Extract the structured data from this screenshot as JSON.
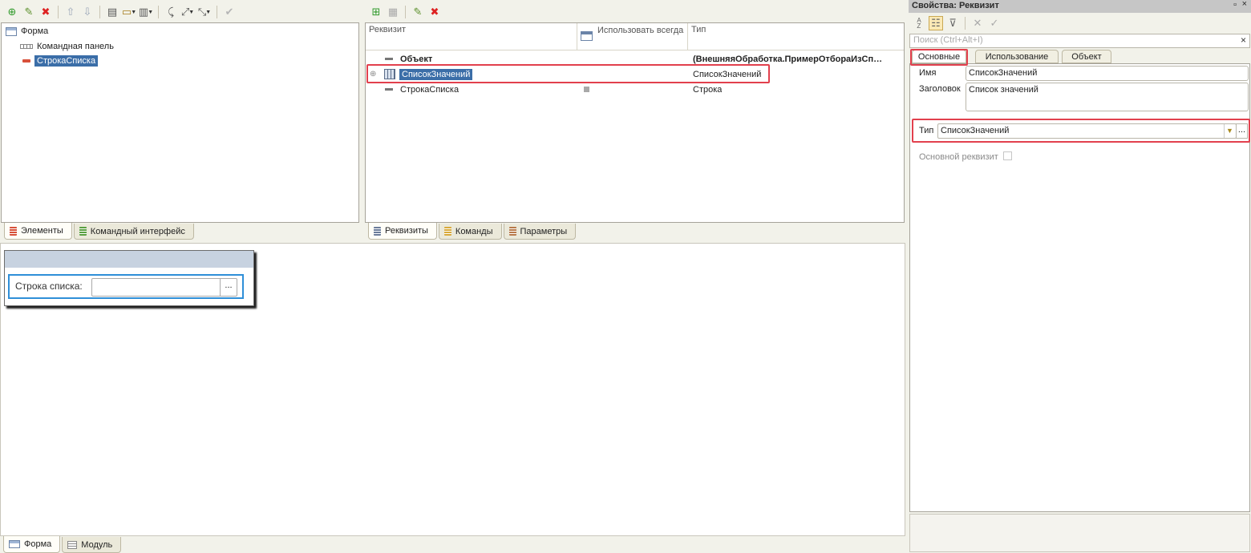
{
  "left_tree": {
    "items": [
      {
        "label": "Форма",
        "icon": "form-icon"
      },
      {
        "label": "Командная панель",
        "icon": "command-panel-icon"
      },
      {
        "label": "СтрокаСписка",
        "icon": "field-icon"
      }
    ],
    "tabs": [
      {
        "label": "Элементы",
        "icon": "elements-icon",
        "color": "#d8513a"
      },
      {
        "label": "Командный интерфейс",
        "icon": "command-interface-icon",
        "color": "#5aa041"
      }
    ]
  },
  "requisites": {
    "columns": {
      "name": "Реквизит",
      "use_always": "Использовать всегда",
      "type": "Тип"
    },
    "rows": [
      {
        "name": "Объект",
        "type": "(ВнешняяОбработка.ПримерОтбораИзСп…",
        "bold": true,
        "icon": "minus-icon"
      },
      {
        "name": "СписокЗначений",
        "type": "СписокЗначений",
        "icon": "value-list-icon",
        "selected": true
      },
      {
        "name": "СтрокаСписка",
        "type": "Строка",
        "icon": "minus-icon"
      }
    ],
    "tabs": [
      {
        "label": "Реквизиты",
        "color": "#6b7c9a"
      },
      {
        "label": "Команды",
        "color": "#d8a93a"
      },
      {
        "label": "Параметры",
        "color": "#b87a4a"
      }
    ]
  },
  "form_preview": {
    "field_label": "Строка списка:",
    "field_value": "",
    "choice_button": "..."
  },
  "bottom_tabs": [
    {
      "label": "Форма",
      "icon": "form-icon"
    },
    {
      "label": "Модуль",
      "icon": "module-icon"
    }
  ],
  "properties": {
    "title": "Свойства: Реквизит",
    "pin": "▫",
    "close": "×",
    "search_placeholder": "Поиск (Ctrl+Alt+I)",
    "search_clear": "×",
    "tabs": [
      "Основные",
      "Использование",
      "Объект"
    ],
    "name_label": "Имя",
    "name_value": "СписокЗначений",
    "title_label": "Заголовок",
    "title_value": "Список значений",
    "type_label": "Тип",
    "type_value": "СписокЗначений",
    "type_more": "...",
    "main_req_label": "Основной реквизит"
  },
  "colors": {
    "accent": "#e2404d",
    "selection": "#3b6ea8",
    "header": "#c7d2e0"
  }
}
